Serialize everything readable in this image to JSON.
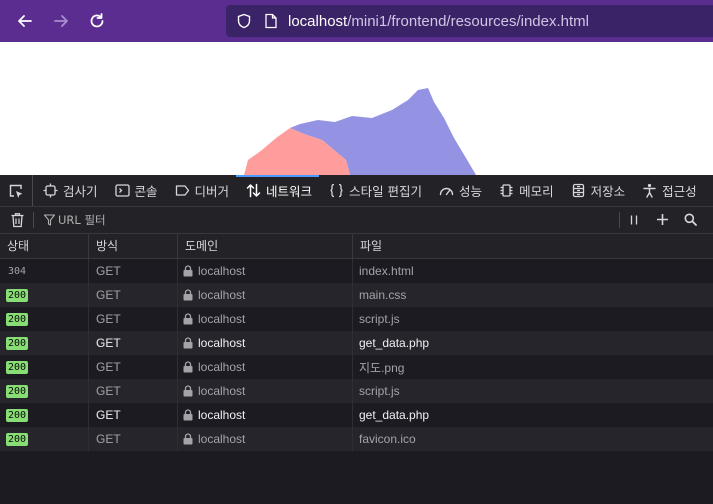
{
  "browser": {
    "url_host": "localhost",
    "url_path": "/mini1/frontend/resources/index.html"
  },
  "devtools": {
    "tabs": [
      {
        "label": "검사기",
        "icon": "inspector-icon"
      },
      {
        "label": "콘솔",
        "icon": "console-icon"
      },
      {
        "label": "디버거",
        "icon": "debugger-icon"
      },
      {
        "label": "네트워크",
        "icon": "network-icon",
        "active": true
      },
      {
        "label": "스타일 편집기",
        "icon": "style-editor-icon"
      },
      {
        "label": "성능",
        "icon": "performance-icon"
      },
      {
        "label": "메모리",
        "icon": "memory-icon"
      },
      {
        "label": "저장소",
        "icon": "storage-icon"
      },
      {
        "label": "접근성",
        "icon": "accessibility-icon"
      }
    ],
    "filter_placeholder": "URL 필터",
    "columns": {
      "status": "상태",
      "method": "방식",
      "domain": "도메인",
      "file": "파일"
    },
    "requests": [
      {
        "status": "304",
        "method": "GET",
        "domain": "localhost",
        "file": "index.html"
      },
      {
        "status": "200",
        "method": "GET",
        "domain": "localhost",
        "file": "main.css"
      },
      {
        "status": "200",
        "method": "GET",
        "domain": "localhost",
        "file": "script.js"
      },
      {
        "status": "200",
        "method": "GET",
        "domain": "localhost",
        "file": "get_data.php"
      },
      {
        "status": "200",
        "method": "GET",
        "domain": "localhost",
        "file": "지도.png"
      },
      {
        "status": "200",
        "method": "GET",
        "domain": "localhost",
        "file": "script.js"
      },
      {
        "status": "200",
        "method": "GET",
        "domain": "localhost",
        "file": "get_data.php"
      },
      {
        "status": "200",
        "method": "GET",
        "domain": "localhost",
        "file": "favicon.ico"
      }
    ]
  },
  "colors": {
    "chrome": "#5b2d90",
    "status_ok": "#86de74",
    "map_blue": "#9493e3",
    "map_red": "#ff9c9c"
  }
}
